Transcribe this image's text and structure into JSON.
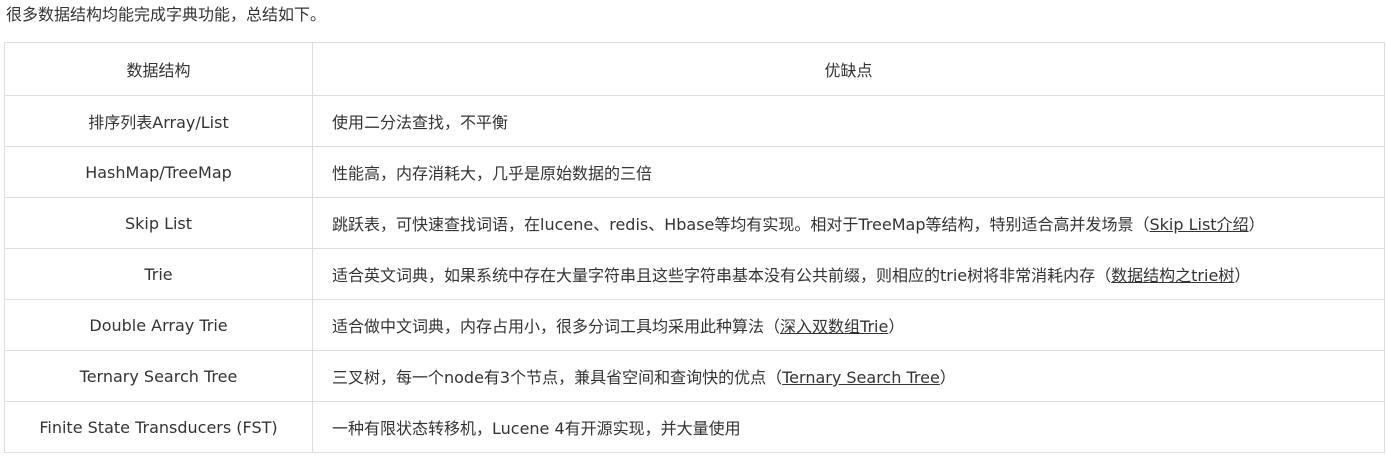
{
  "intro": "很多数据结构均能完成字典功能，总结如下。",
  "table": {
    "headers": [
      "数据结构",
      "优缺点"
    ],
    "rows": [
      {
        "name": "排序列表Array/List",
        "desc": "使用二分法查找，不平衡",
        "link": "",
        "tail": ""
      },
      {
        "name": "HashMap/TreeMap",
        "desc": "性能高，内存消耗大，几乎是原始数据的三倍",
        "link": "",
        "tail": ""
      },
      {
        "name": "Skip List",
        "desc": "跳跃表，可快速查找词语，在lucene、redis、Hbase等均有实现。相对于TreeMap等结构，特别适合高并发场景（",
        "link": "Skip List介绍",
        "tail": "）"
      },
      {
        "name": "Trie",
        "desc": "适合英文词典，如果系统中存在大量字符串且这些字符串基本没有公共前缀，则相应的trie树将非常消耗内存（",
        "link": "数据结构之trie树",
        "tail": "）"
      },
      {
        "name": "Double Array Trie",
        "desc": "适合做中文词典，内存占用小，很多分词工具均采用此种算法（",
        "link": "深入双数组Trie",
        "tail": "）"
      },
      {
        "name": "Ternary Search Tree",
        "desc": "三叉树，每一个node有3个节点，兼具省空间和查询快的优点（",
        "link": "Ternary Search Tree",
        "tail": "）"
      },
      {
        "name": "Finite State Transducers (FST)",
        "desc": "一种有限状态转移机，Lucene 4有开源实现，并大量使用",
        "link": "",
        "tail": ""
      }
    ]
  }
}
